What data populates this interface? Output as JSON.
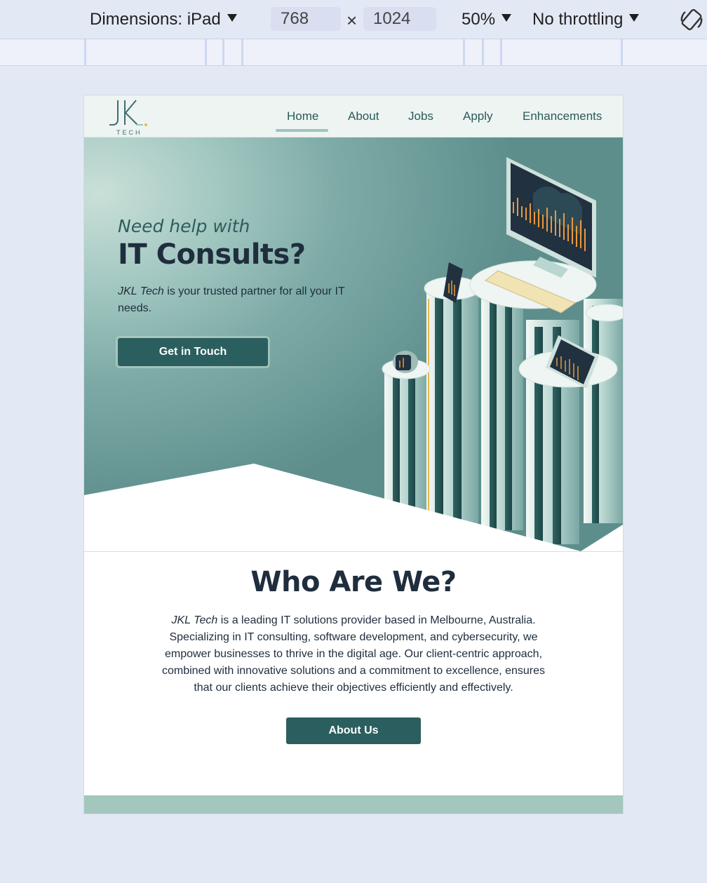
{
  "devtools": {
    "dimensions_label": "Dimensions: iPad",
    "width_value": "768",
    "height_value": "1024",
    "times_glyph": "×",
    "zoom": "50%",
    "throttling": "No throttling"
  },
  "site": {
    "logo": {
      "letters": "JK",
      "subtext": "TECH"
    },
    "nav": [
      {
        "label": "Home",
        "active": true
      },
      {
        "label": "About"
      },
      {
        "label": "Jobs"
      },
      {
        "label": "Apply"
      },
      {
        "label": "Enhancements"
      }
    ],
    "hero": {
      "lead": "Need help with",
      "headline": "IT Consults?",
      "tagline_brand": "JKL Tech",
      "tagline_rest": " is your trusted partner for all your IT needs.",
      "cta": "Get in Touch"
    },
    "about": {
      "title": "Who Are We?",
      "brand": "JKL Tech",
      "body": " is a leading IT solutions provider based in Melbourne, Australia. Specializing in IT consulting, software development, and cybersecurity, we empower businesses to thrive in the digital age. Our client-centric approach, combined with innovative solutions and a commitment to excellence, ensures that our clients achieve their objectives efficiently and effectively.",
      "button": "About Us"
    }
  },
  "colors": {
    "primary": "#2b5e5f",
    "heading": "#1f2d3d",
    "nav_bg": "#eef4f2",
    "footer": "#a3c7bd",
    "chart_accent": "#e89a3c"
  }
}
